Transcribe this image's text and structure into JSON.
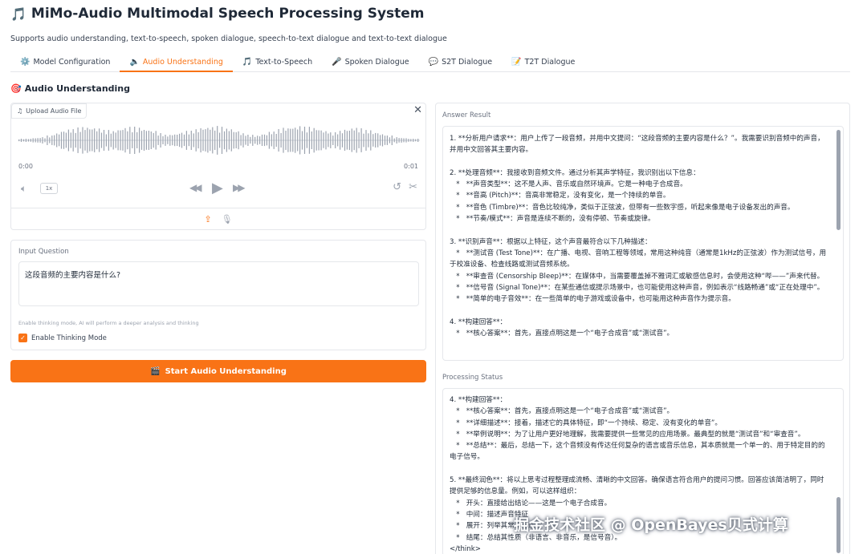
{
  "app": {
    "title_icon": "🎵",
    "title": "MiMo-Audio Multimodal Speech Processing System",
    "subtitle": "Supports audio understanding, text-to-speech, spoken dialogue, speech-to-text dialogue and text-to-text dialogue"
  },
  "tabs": [
    {
      "icon": "⚙️",
      "label": "Model Configuration",
      "active": false
    },
    {
      "icon": "🔈",
      "label": "Audio Understanding",
      "active": true
    },
    {
      "icon": "🎵",
      "label": "Text-to-Speech",
      "active": false
    },
    {
      "icon": "🎤",
      "label": "Spoken Dialogue",
      "active": false
    },
    {
      "icon": "💬",
      "label": "S2T Dialogue",
      "active": false
    },
    {
      "icon": "📝",
      "label": "T2T Dialogue",
      "active": false
    }
  ],
  "section": {
    "icon": "🎯",
    "title": "Audio Understanding"
  },
  "audio": {
    "upload_label": "Upload Audio File",
    "time_start": "0:00",
    "time_end": "0:01",
    "speed": "1x"
  },
  "question": {
    "label": "Input Question",
    "value": "这段音频的主要内容是什么?",
    "info": "Enable thinking mode, AI will perform a deeper analysis and thinking",
    "checkbox_label": "Enable Thinking Mode",
    "checked": true
  },
  "start_button": {
    "icon": "🎬",
    "label": "Start Audio Understanding"
  },
  "answer": {
    "label": "Answer Result",
    "lines": [
      "1. **分析用户请求**：用户上传了一段音频，并用中文提问：“这段音频的主要内容是什么？”。我需要识别音频中的声音，并用中文回答其主要内容。",
      "",
      "2. **处理音频**：我接收到音频文件。通过分析其声学特征，我识别出以下信息：",
      "   *   **声音类型**：这不是人声、音乐或自然环境声。它是一种电子合成音。",
      "   *   **音高 (Pitch)**：音高非常稳定，没有变化，是一个持续的单音。",
      "   *   **音色 (Timbre)**：音色比较纯净，类似于正弦波，但带有一些数字感，听起来像是电子设备发出的声音。",
      "   *   **节奏/模式**：声音是连续不断的，没有停顿、节奏或旋律。",
      "",
      "3. **识别声音**：根据以上特征，这个声音最符合以下几种描述：",
      "   *   **测试音 (Test Tone)**：在广播、电视、音响工程等领域，常用这种纯音（通常是1kHz的正弦波）作为测试信号，用于校准设备、检查线路或测试音频系统。",
      "   *   **审查音 (Censorship Bleep)**：在媒体中，当需要覆盖掉不雅词汇或敏感信息时，会使用这种“哔——”声来代替。",
      "   *   **信号音 (Signal Tone)**：在某些通信或提示场景中，也可能使用这种声音，例如表示“线路畅通”或“正在处理中”。",
      "   *   **简单的电子音效**：在一些简单的电子游戏或设备中，也可能用这种声音作为提示音。",
      "",
      "4. **构建回答**：",
      "   *   **核心答案**：首先，直接点明这是一个“电子合成音”或“测试音”。"
    ]
  },
  "processing": {
    "label": "Processing Status",
    "lines": [
      "4. **构建回答**：",
      "   *   **核心答案**：首先，直接点明这是一个“电子合成音”或“测试音”。",
      "   *   **详细描述**：接着，描述它的具体特征，即“一个持续、稳定、没有变化的单音”。",
      "   *   **举例说明**：为了让用户更好地理解，我需要提供一些常见的应用场景。最典型的就是“测试音”和“审查音”。",
      "   *   **总结**：最后，总结一下，这个音频没有传达任何复杂的语言或音乐信息，其本质就是一个单一的、用于特定目的的电子信号。",
      "",
      "5. **最终润色**：将以上思考过程整理成流畅、清晰的中文回答。确保语言符合用户的提问习惯。回答应该简洁明了，同时提供足够的信息量。例如，可以这样组织：",
      "   *   开头：直接给出结论——这是一个电子合成音。",
      "   *   中间：描述声音特征",
      "   *   展开：列举其常见用途",
      "   *   结尾：总结其性质（非语言、非音乐，是信号音）。",
      "</think>"
    ]
  },
  "watermark": "掘金技术社区 @ OpenBayes贝式计算",
  "colors": {
    "accent": "#f97316",
    "border": "#e5e7eb",
    "muted": "#6b7280"
  }
}
